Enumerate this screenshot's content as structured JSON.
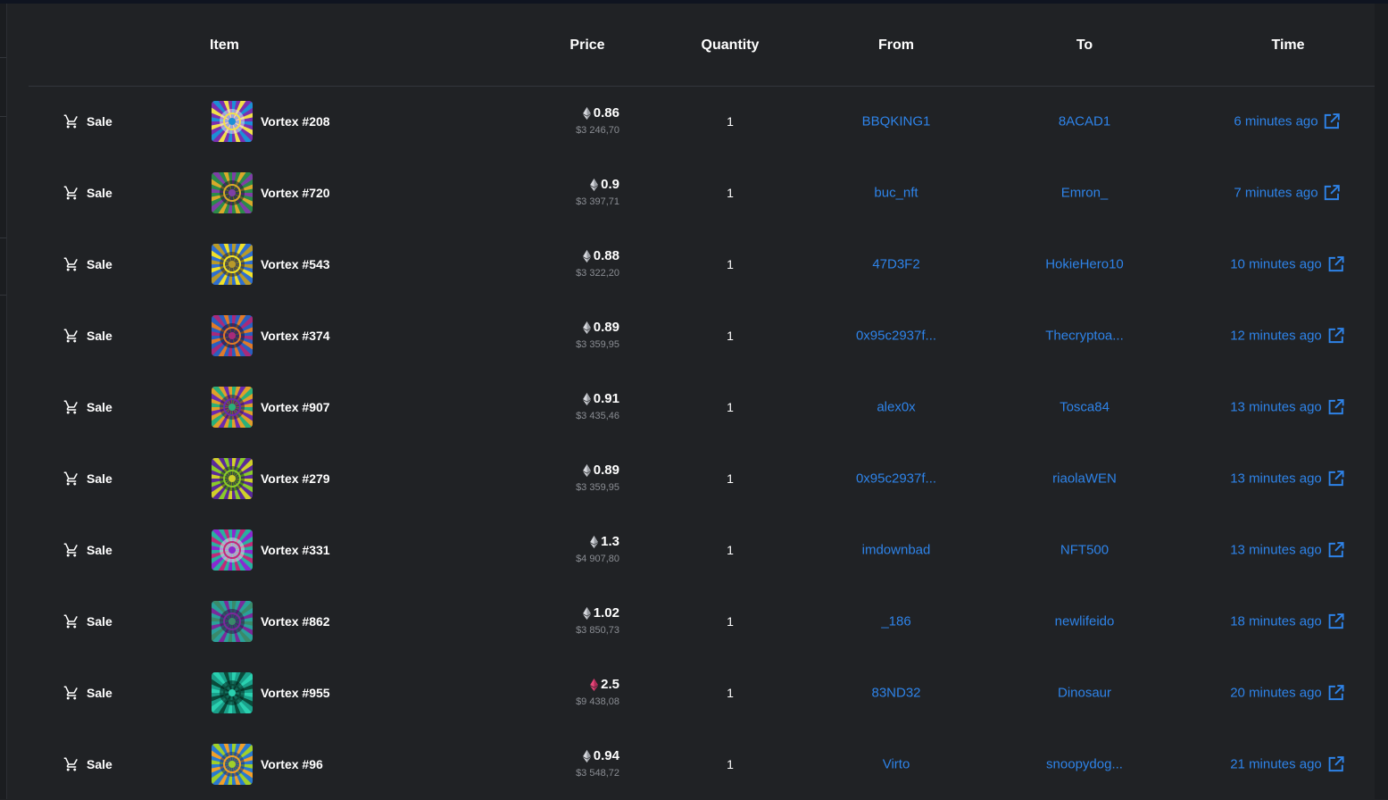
{
  "table": {
    "headers": {
      "item": "Item",
      "price": "Price",
      "quantity": "Quantity",
      "from": "From",
      "to": "To",
      "time": "Time"
    },
    "rows": [
      {
        "event": "Sale",
        "item": "Vortex #208",
        "price": "0.86",
        "usd": "$3 246,70",
        "quantity": "1",
        "from": "BBQKING1",
        "to": "8ACAD1",
        "time": "6 minutes ago"
      },
      {
        "event": "Sale",
        "item": "Vortex #720",
        "price": "0.9",
        "usd": "$3 397,71",
        "quantity": "1",
        "from": "buc_nft",
        "to": "Emron_",
        "time": "7 minutes ago"
      },
      {
        "event": "Sale",
        "item": "Vortex #543",
        "price": "0.88",
        "usd": "$3 322,20",
        "quantity": "1",
        "from": "47D3F2",
        "to": "HokieHero10",
        "time": "10 minutes ago"
      },
      {
        "event": "Sale",
        "item": "Vortex #374",
        "price": "0.89",
        "usd": "$3 359,95",
        "quantity": "1",
        "from": "0x95c2937f...",
        "to": "Thecryptoa...",
        "time": "12 minutes ago"
      },
      {
        "event": "Sale",
        "item": "Vortex #907",
        "price": "0.91",
        "usd": "$3 435,46",
        "quantity": "1",
        "from": "alex0x",
        "to": "Tosca84",
        "time": "13 minutes ago"
      },
      {
        "event": "Sale",
        "item": "Vortex #279",
        "price": "0.89",
        "usd": "$3 359,95",
        "quantity": "1",
        "from": "0x95c2937f...",
        "to": "riaolaWEN",
        "time": "13 minutes ago"
      },
      {
        "event": "Sale",
        "item": "Vortex #331",
        "price": "1.3",
        "usd": "$4 907,80",
        "quantity": "1",
        "from": "imdownbad",
        "to": "NFT500",
        "time": "13 minutes ago"
      },
      {
        "event": "Sale",
        "item": "Vortex #862",
        "price": "1.02",
        "usd": "$3 850,73",
        "quantity": "1",
        "from": "_186",
        "to": "newlifeido",
        "time": "18 minutes ago"
      },
      {
        "event": "Sale",
        "item": "Vortex #955",
        "price": "2.5",
        "usd": "$9 438,08",
        "quantity": "1",
        "from": "83ND32",
        "to": "Dinosaur",
        "time": "20 minutes ago"
      },
      {
        "event": "Sale",
        "item": "Vortex #96",
        "price": "0.94",
        "usd": "$3 548,72",
        "quantity": "1",
        "from": "Virto",
        "to": "snoopydog...",
        "time": "21 minutes ago"
      }
    ]
  },
  "colors": {
    "background": "#202225",
    "link": "#2e83e8",
    "text": "#ffffff",
    "muted": "#8a8d93",
    "eth_gray": "#d7d9de",
    "weth_pink": "#e8487a"
  },
  "icons": {
    "event": "shopping-cart-icon",
    "currency": "eth-icon",
    "currency_weth": "weth-icon",
    "time_link": "external-link-icon"
  }
}
